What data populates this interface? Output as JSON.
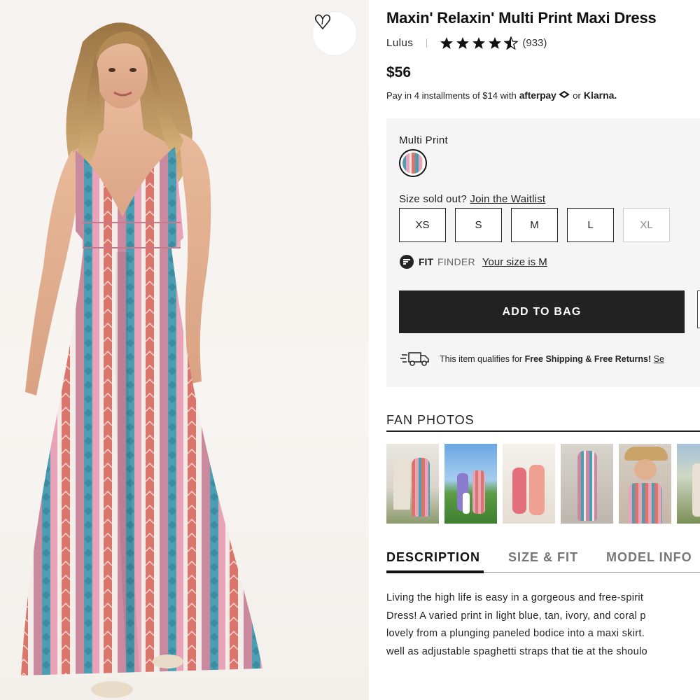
{
  "product": {
    "title": "Maxin' Relaxin' Multi Print Maxi Dress",
    "brand": "Lulus",
    "rating": 4.5,
    "reviews": "(933)",
    "price": "$56",
    "installments_prefix": "Pay in 4 installments of $14 with",
    "afterpay": "afterpay",
    "or": "or",
    "klarna": "Klarna."
  },
  "options": {
    "color_label": "Multi Print",
    "size_question": "Size sold out?",
    "waitlist_link": "Join the Waitlist",
    "sizes": [
      {
        "label": "XS",
        "available": true
      },
      {
        "label": "S",
        "available": true
      },
      {
        "label": "M",
        "available": true
      },
      {
        "label": "L",
        "available": true
      },
      {
        "label": "XL",
        "available": false
      }
    ],
    "fit_word": "FIT",
    "finder_word": "FINDER",
    "fit_link": "Your size is M",
    "add_to_bag": "ADD TO BAG",
    "shipping_prefix": "This item qualifies for",
    "shipping_bold": "Free Shipping & Free Returns!",
    "shipping_link": "Se"
  },
  "fan_photos": {
    "title": "FAN PHOTOS",
    "count": 6
  },
  "tabs": [
    "DESCRIPTION",
    "SIZE & FIT",
    "MODEL INFO"
  ],
  "description": [
    "Living the high life is easy in a gorgeous and free-spirit",
    "Dress! A varied print in light blue, tan, ivory, and coral p",
    "lovely from a plunging paneled bodice into a maxi skirt.",
    "well as adjustable spaghetti straps that tie at the shoulo"
  ],
  "colors": {
    "primary_button": "#222222",
    "panel_bg": "#f5f5f5",
    "print_blue": "#4d9db3",
    "print_pink": "#e9a3b8",
    "print_coral": "#d9756a"
  },
  "icons": [
    "heart-icon",
    "star-icon",
    "afterpay-icon",
    "fit-finder-icon",
    "shipping-truck-icon"
  ]
}
